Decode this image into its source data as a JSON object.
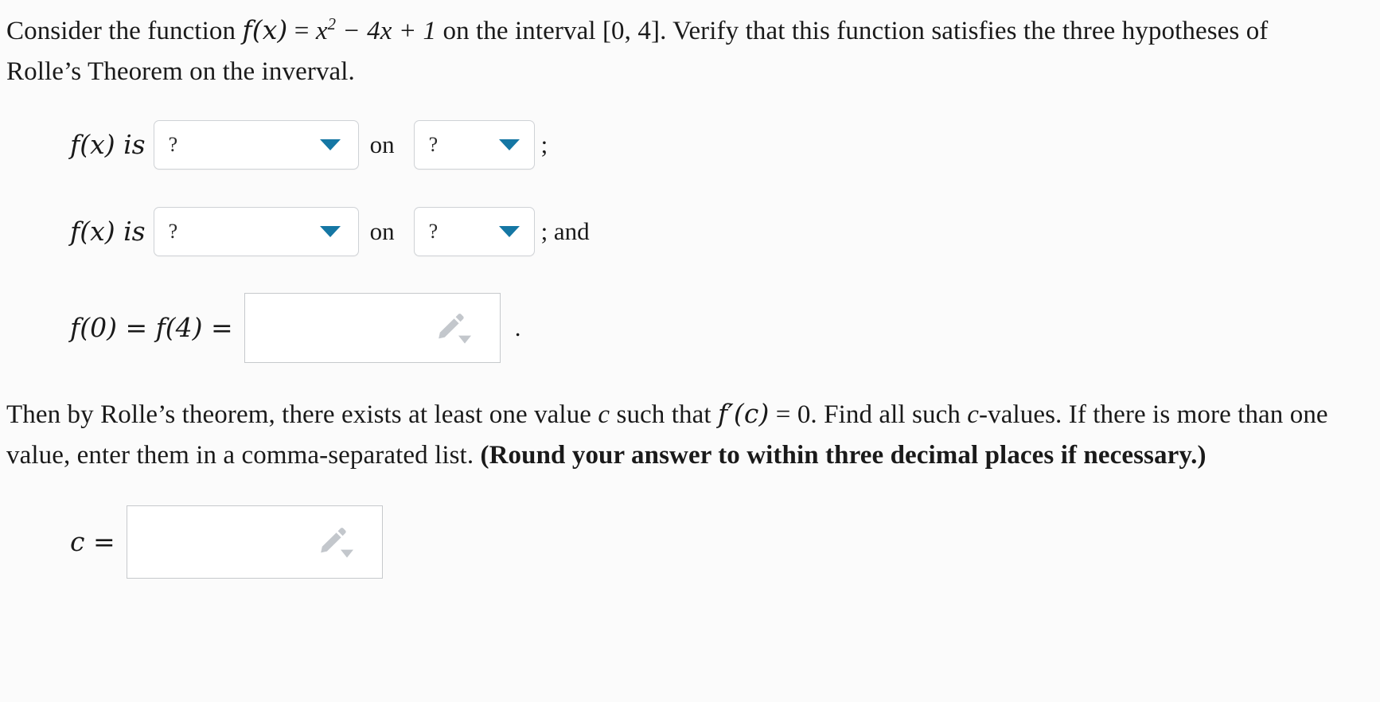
{
  "problem": {
    "intro_part1": "Consider the function ",
    "intro_fx": "f(x)",
    "intro_eq": " = ",
    "intro_expr_base": "x",
    "intro_expr_exp": "2",
    "intro_expr_rest": " − 4x + 1",
    "intro_part2": " on the interval ",
    "intro_interval": "[0, 4]",
    "intro_part3": ". Verify that this function satisfies the three hypotheses of Rolle’s Theorem on the inverval."
  },
  "rows": [
    {
      "label": "f(x) is",
      "select_a": {
        "value": "?",
        "width": "wide"
      },
      "connector": "on",
      "select_b": {
        "value": "?",
        "width": "narrow"
      },
      "tail": ";"
    },
    {
      "label": "f(x) is",
      "select_a": {
        "value": "?",
        "width": "wide"
      },
      "connector": "on",
      "select_b": {
        "value": "?",
        "width": "narrow"
      },
      "tail": "; and"
    }
  ],
  "equality_row": {
    "label": "f(0) = f(4) =",
    "input_value": "",
    "input_placeholder": "",
    "tail": "."
  },
  "then_paragraph": {
    "part1": "Then by Rolle’s theorem, there exists at least one value ",
    "var_c": "c",
    "part2": " such that ",
    "deriv": "f′(c)",
    "part3": " = 0. Find all such ",
    "var_c2": "c",
    "part4": "-values. If there is more than one value, enter them in a comma-separated list. ",
    "bold_part": "(Round your answer to within three decimal places if necessary.)"
  },
  "c_row": {
    "label": "c =",
    "input_value": "",
    "input_placeholder": ""
  },
  "icons": {
    "dropdown_caret": "chevron-down-icon",
    "pencil": "pencil-icon"
  },
  "colors": {
    "page_background": "#fbfbfb",
    "text": "#1a1a1a",
    "caret_blue": "#1577a4",
    "select_border": "#cfd2d6",
    "input_border": "#c6c9cc",
    "pencil_gray": "#c3c7cc"
  }
}
